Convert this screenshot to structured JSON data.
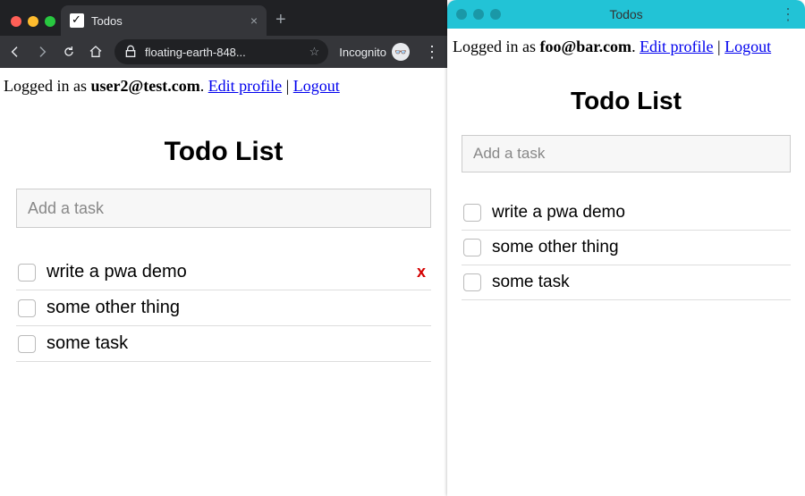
{
  "left": {
    "browser": {
      "tab_title": "Todos",
      "url_display": "floating-earth-848...",
      "mode_label": "Incognito"
    },
    "login": {
      "prefix": "Logged in as ",
      "email": "user2@test.com",
      "dot": ". ",
      "edit_label": "Edit profile",
      "sep": " | ",
      "logout_label": "Logout"
    },
    "app": {
      "heading": "Todo List",
      "input_placeholder": "Add a task",
      "delete_glyph": "x",
      "tasks": [
        "write a pwa demo",
        "some other thing",
        "some task"
      ],
      "hovered_index": 0
    }
  },
  "right": {
    "window_title": "Todos",
    "login": {
      "prefix": "Logged in as ",
      "email": "foo@bar.com",
      "dot": ". ",
      "edit_label": "Edit profile",
      "sep": " | ",
      "logout_label": "Logout"
    },
    "app": {
      "heading": "Todo List",
      "input_placeholder": "Add a task",
      "tasks": [
        "write a pwa demo",
        "some other thing",
        "some task"
      ]
    }
  }
}
